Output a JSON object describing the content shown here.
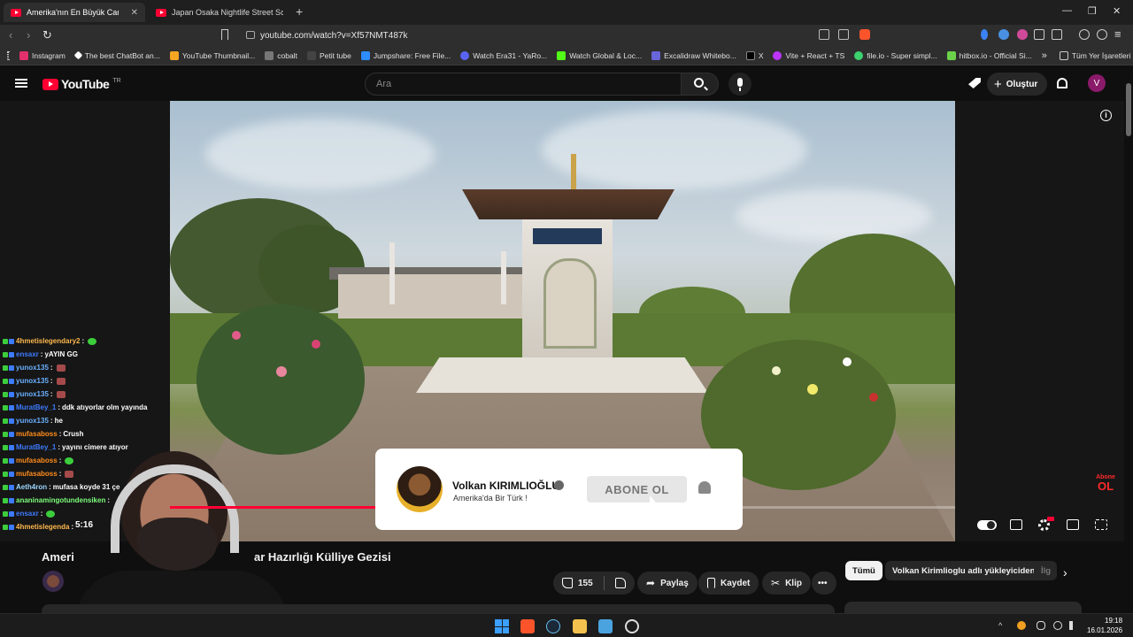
{
  "browser": {
    "tabs": [
      {
        "label": "Amerika'nın En Büyük Camisi"
      },
      {
        "label": "Japan Osaka Nightlife Street Scenes"
      }
    ],
    "url": "youtube.com/watch?v=Xf57NMT487k",
    "bookmarks": [
      {
        "label": "Instagram",
        "color": "#e1306c"
      },
      {
        "label": "The best ChatBot an...",
        "color": "#ffffff"
      },
      {
        "label": "YouTube Thumbnail...",
        "color": "#f5a623"
      },
      {
        "label": "cobalt",
        "color": "#777777"
      },
      {
        "label": "Petit tube",
        "color": "#444444"
      },
      {
        "label": "Jumpshare: Free File...",
        "color": "#2d8cff"
      },
      {
        "label": "Watch Era31 - YaRo...",
        "color": "#5865f2"
      },
      {
        "label": "Watch Global & Loc...",
        "color": "#53fc18"
      },
      {
        "label": "Excalidraw Whitebo...",
        "color": "#6965db"
      },
      {
        "label": "X",
        "color": "#000000"
      },
      {
        "label": "Vite + React + TS",
        "color": "#bd34fe"
      },
      {
        "label": "file.io - Super simpl...",
        "color": "#3bd16f"
      },
      {
        "label": "hitbox.io - Official Si...",
        "color": "#6bd14a"
      }
    ],
    "all_bookmarks": "Tüm Yer İşaretleri"
  },
  "youtube": {
    "logo_text": "YouTube",
    "logo_region": "TR",
    "search_placeholder": "Ara",
    "create_label": "Oluştur",
    "avatar_letter": "V"
  },
  "player": {
    "current_time": "5:16",
    "progress_fraction": 0.474,
    "card": {
      "channel_name": "Volkan KIRIMLIOĞLU",
      "subtitle": "Amerika'da Bir Türk !",
      "subscribe_label": "ABONE OL"
    },
    "watermark_top": "Abone",
    "watermark_bottom": "OL"
  },
  "chat": [
    {
      "user": "4hmetislegendary2",
      "color": "#ffb84d",
      "msg": "",
      "emote": "green"
    },
    {
      "user": "ensaxr",
      "color": "#3d7bff",
      "msg": "yAYIN GG",
      "emote": ""
    },
    {
      "user": "yunox135",
      "color": "#6ab0ff",
      "msg": "",
      "emote": "red"
    },
    {
      "user": "yunox135",
      "color": "#6ab0ff",
      "msg": "",
      "emote": "red"
    },
    {
      "user": "yunox135",
      "color": "#6ab0ff",
      "msg": "",
      "emote": "red"
    },
    {
      "user": "MuratBey_1",
      "color": "#3d7bff",
      "msg": "ddk atıyorlar olm yayında",
      "emote": ""
    },
    {
      "user": "yunox135",
      "color": "#6ab0ff",
      "msg": "he",
      "emote": ""
    },
    {
      "user": "mufasaboss",
      "color": "#ff8c1a",
      "msg": "Crush",
      "emote": ""
    },
    {
      "user": "MuratBey_1",
      "color": "#3d7bff",
      "msg": "yayını cimere atıyor",
      "emote": ""
    },
    {
      "user": "mufasaboss",
      "color": "#ff8c1a",
      "msg": "",
      "emote": "green"
    },
    {
      "user": "mufasaboss",
      "color": "#ff8c1a",
      "msg": "",
      "emote": "red"
    },
    {
      "user": "Aeth4ron",
      "color": "#9ad7ff",
      "msg": "mufasa koyde 31 çe",
      "emote": ""
    },
    {
      "user": "ananinamingotundensiken",
      "color": "#7cff7c",
      "msg": "",
      "emote": ""
    },
    {
      "user": "ensaxr",
      "color": "#3d7bff",
      "msg": "",
      "emote": "green"
    },
    {
      "user": "4hmetislegenda",
      "color": "#ffb84d",
      "msg": "",
      "emote": ""
    }
  ],
  "video": {
    "title_start": "Ameri",
    "title_end": "ar Hazırlığı Külliye Gezisi",
    "likes": "155",
    "share_label": "Paylaş",
    "save_label": "Kaydet",
    "clip_label": "Klip"
  },
  "related_chips": [
    {
      "label": "Tümü",
      "active": true
    },
    {
      "label": "Volkan Kirimlioglu adlı yükleyiciden",
      "active": false
    },
    {
      "label": "İlg",
      "active": false
    }
  ],
  "taskbar": {
    "time": "19:18",
    "date": "16.01.2026"
  }
}
